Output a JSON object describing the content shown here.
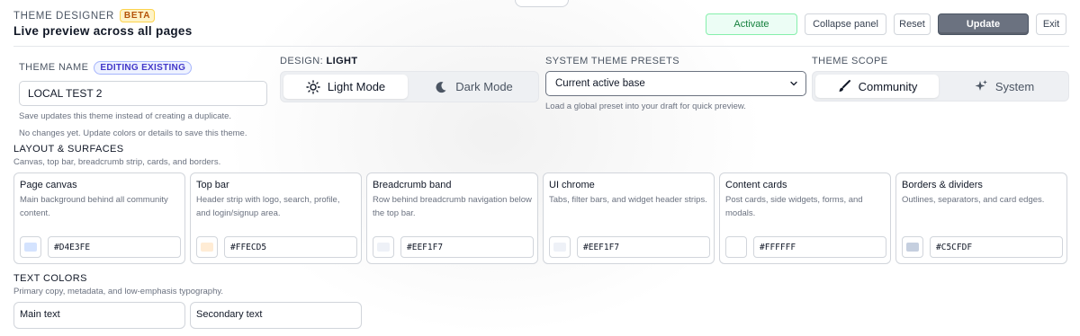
{
  "header": {
    "kicker": "THEME DESIGNER",
    "beta_badge": "BETA",
    "subtitle": "Live preview across all pages",
    "actions": {
      "activate": "Activate",
      "collapse": "Collapse panel",
      "reset": "Reset",
      "update": "Update",
      "exit": "Exit"
    }
  },
  "theme_name": {
    "label": "THEME NAME",
    "badge": "EDITING EXISTING",
    "value": "LOCAL TEST 2",
    "hint1": "Save updates this theme instead of creating a duplicate.",
    "hint2": "No changes yet. Update colors or details to save this theme."
  },
  "design": {
    "label": "DESIGN:",
    "current": "LIGHT",
    "options": [
      "Light Mode",
      "Dark Mode"
    ],
    "selected": "Light Mode"
  },
  "presets": {
    "label": "SYSTEM THEME PRESETS",
    "selected": "Current active base",
    "hint": "Load a global preset into your draft for quick preview."
  },
  "scope": {
    "label": "THEME SCOPE",
    "options": [
      "Community",
      "System"
    ],
    "selected": "Community"
  },
  "layout_section": {
    "title": "LAYOUT & SURFACES",
    "subtitle": "Canvas, top bar, breadcrumb strip, cards, and borders.",
    "cards": [
      {
        "title": "Page canvas",
        "desc": "Main background behind all community content.",
        "hex": "#D4E3FE",
        "color": "#D4E3FE"
      },
      {
        "title": "Top bar",
        "desc": "Header strip with logo, search, profile, and login/signup area.",
        "hex": "#FFECD5",
        "color": "#FFECD5"
      },
      {
        "title": "Breadcrumb band",
        "desc": "Row behind breadcrumb navigation below the top bar.",
        "hex": "#EEF1F7",
        "color": "#EEF1F7"
      },
      {
        "title": "UI chrome",
        "desc": "Tabs, filter bars, and widget header strips.",
        "hex": "#EEF1F7",
        "color": "#EEF1F7"
      },
      {
        "title": "Content cards",
        "desc": "Post cards, side widgets, forms, and modals.",
        "hex": "#FFFFFF",
        "color": "#FFFFFF"
      },
      {
        "title": "Borders & dividers",
        "desc": "Outlines, separators, and card edges.",
        "hex": "#C5CFDF",
        "color": "#C5CFDF"
      }
    ]
  },
  "text_section": {
    "title": "TEXT COLORS",
    "subtitle": "Primary copy, metadata, and low-emphasis typography.",
    "cards": [
      {
        "title": "Main text"
      },
      {
        "title": "Secondary text"
      }
    ]
  }
}
